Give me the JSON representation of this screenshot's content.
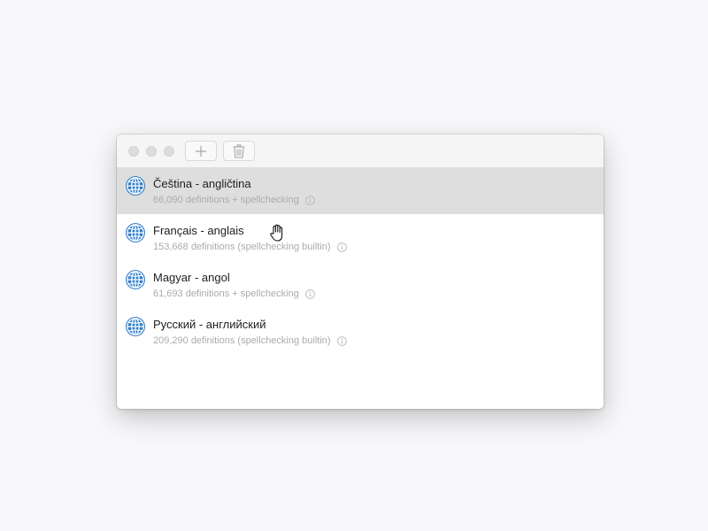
{
  "window": {
    "toolbar": {
      "add_icon": "plus-icon",
      "delete_icon": "trash-icon"
    },
    "dictionaries": [
      {
        "title": "Čeština - angličtina",
        "subtitle": "66,090 definitions + spellchecking",
        "selected": true
      },
      {
        "title": "Français - anglais",
        "subtitle": "153,668 definitions (spellchecking builtin)",
        "selected": false
      },
      {
        "title": "Magyar - angol",
        "subtitle": "61,693 definitions + spellchecking",
        "selected": false
      },
      {
        "title": "Русский - английский",
        "subtitle": "209,290 definitions (spellchecking builtin)",
        "selected": false
      }
    ]
  },
  "colors": {
    "globe": "#2f7fce",
    "selected_row": "#dedede",
    "subtitle": "#ababab"
  },
  "cursor_icon": "open-hand-icon"
}
